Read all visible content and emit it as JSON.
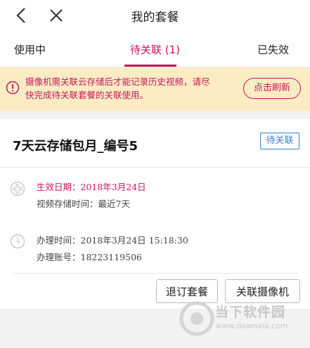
{
  "header": {
    "title": "我的套餐"
  },
  "tabs": [
    {
      "label": "使用中"
    },
    {
      "label": "待关联 (1)"
    },
    {
      "label": "已失效"
    }
  ],
  "notice": {
    "line1": "摄像机需关联云存储后才能记录历史视频，请尽",
    "line2": "快完成待关联套餐的关联使用。",
    "refresh_label": "点击刷新"
  },
  "plan": {
    "name": "7天云存储包月_编号5",
    "status": "待关联",
    "effective_date": "生效日期：2018年3月24日",
    "storage_time": "视频存储时间：最近7天",
    "process_time": "办理时间：2018年3月24日 15:18:30",
    "account": "办理账号：18223119506"
  },
  "actions": {
    "unsubscribe_label": "退订套餐",
    "link_camera_label": "关联摄像机"
  },
  "watermark": {
    "text": "当下软件园",
    "url": "www.downxia.com"
  },
  "colors": {
    "accent": "#c2185b",
    "notice_bg": "#fbecc4",
    "badge": "#3a7bd5"
  }
}
